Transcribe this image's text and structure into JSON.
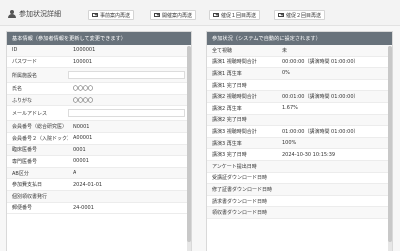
{
  "header": {
    "title": "参加状況詳細",
    "buttons": [
      {
        "label": "事前案内再送"
      },
      {
        "label": "開催案内再送"
      },
      {
        "label": "催促１回目再送"
      },
      {
        "label": "催促２回目再送"
      }
    ]
  },
  "basic": {
    "heading": "基本情報（参加者情報を更新して変更できます）",
    "rows": [
      {
        "label": "ID",
        "value": "1000001"
      },
      {
        "label": "パスワード",
        "value": "100001"
      },
      {
        "label": "所属施設名",
        "value": "",
        "input": true
      },
      {
        "label": "氏名",
        "value": "〇〇〇〇"
      },
      {
        "label": "ふりがな",
        "value": "〇〇〇〇"
      },
      {
        "label": "メールアドレス",
        "value": "",
        "input": true
      },
      {
        "label": "会員番号（総合研究医）",
        "value": "N0001"
      },
      {
        "label": "会員番号２（入院ドック）",
        "value": "A00001"
      },
      {
        "label": "臨床医番号",
        "value": "0001"
      },
      {
        "label": "専門医番号",
        "value": "00001"
      },
      {
        "label": "AB区分",
        "value": "A"
      },
      {
        "label": "参加費支払日",
        "value": "2024-01-01"
      },
      {
        "label": "個別領収書発行",
        "value": ""
      },
      {
        "label": "郵便番号",
        "value": "24-0001"
      }
    ]
  },
  "status": {
    "heading": "参加状況（システムで自動的に設定されます）",
    "rows": [
      {
        "label": "全て視聴",
        "value": "未"
      },
      {
        "label": "講演1 視聴時間合計",
        "value": "00:00:00（講演時間 01:00:00）"
      },
      {
        "label": "講演1 再生率",
        "value": "0%"
      },
      {
        "label": "講演1 完了日時",
        "value": ""
      },
      {
        "label": "講演2 視聴時間合計",
        "value": "00:01:00（講演時間 01:00:00）"
      },
      {
        "label": "講演2 再生率",
        "value": "1.67%"
      },
      {
        "label": "講演2 完了日時",
        "value": ""
      },
      {
        "label": "講演3 視聴時間合計",
        "value": "01:00:00（講演時間 01:00:00）"
      },
      {
        "label": "講演3 再生率",
        "value": "100%"
      },
      {
        "label": "講演3 完了日時",
        "value": "2024-10-30 10:15:39"
      },
      {
        "label": "アンケート提出日時",
        "value": ""
      },
      {
        "label": "受講証ダウンロード日時",
        "value": ""
      },
      {
        "label": "修了証書ダウンロード日時",
        "value": ""
      },
      {
        "label": "請求書ダウンロード日時",
        "value": ""
      },
      {
        "label": "領収書ダウンロード日時",
        "value": ""
      }
    ]
  }
}
